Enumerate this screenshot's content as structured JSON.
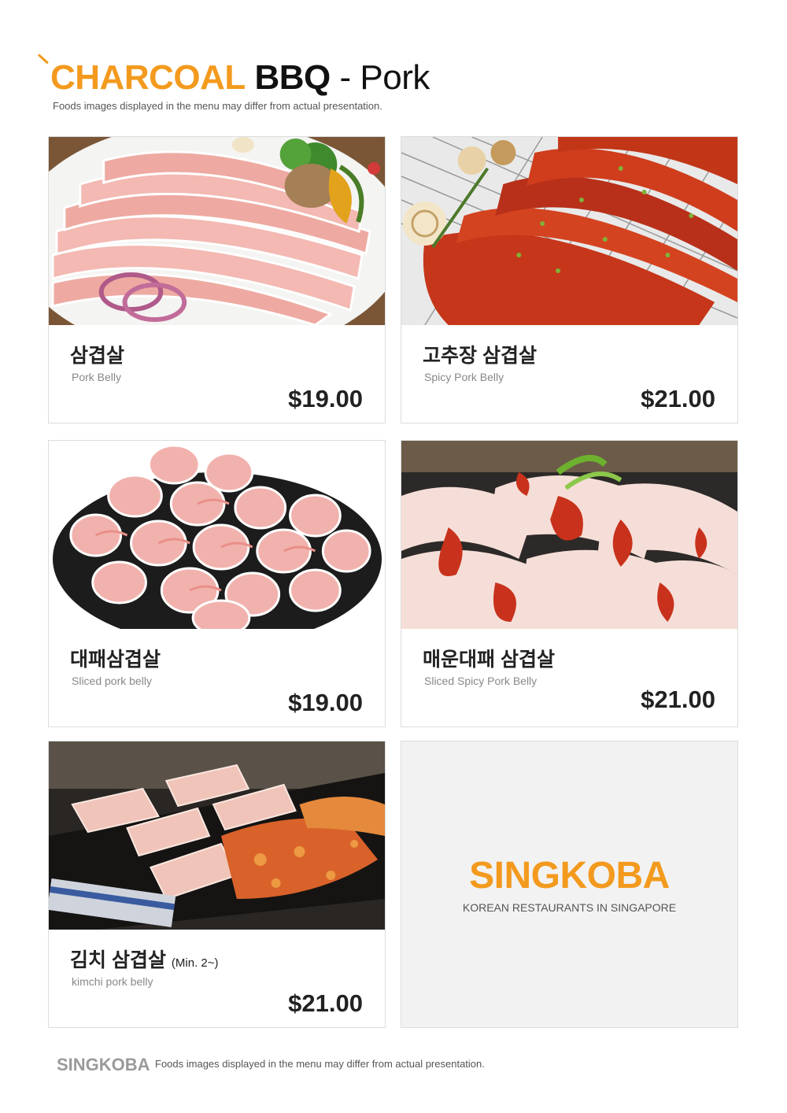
{
  "header": {
    "title_part1": "CHARCOAL",
    "title_part2": "BBQ",
    "title_part3": "- Pork",
    "subtitle": "Foods images displayed in the menu may differ from actual presentation."
  },
  "items": [
    {
      "name": "삼겹살",
      "name_extra": "",
      "english": "Pork Belly",
      "price": "$19.00"
    },
    {
      "name": "고추장 삼겹살",
      "name_extra": "",
      "english": "Spicy Pork Belly",
      "price": "$21.00"
    },
    {
      "name": "대패삼겹살",
      "name_extra": "",
      "english": "Sliced pork belly",
      "price": "$19.00"
    },
    {
      "name": "매운대패 삼겹살",
      "name_extra": "",
      "english": "Sliced Spicy Pork Belly",
      "price": "$21.00"
    },
    {
      "name": "김치 삼겹살",
      "name_extra": "(Min. 2~)",
      "english": "kimchi pork belly",
      "price": "$21.00"
    }
  ],
  "brand_card": {
    "name": "SINGKOBA",
    "tagline": "KOREAN RESTAURANTS IN SINGAPORE"
  },
  "footer": {
    "brand": "SINGKOBA",
    "note": "Foods images displayed in the menu may differ from actual presentation."
  },
  "colors": {
    "accent": "#f39a1e",
    "text": "#222222",
    "muted": "#888888",
    "card_border": "#dcdcdc",
    "brand_bg": "#f2f2f2"
  }
}
